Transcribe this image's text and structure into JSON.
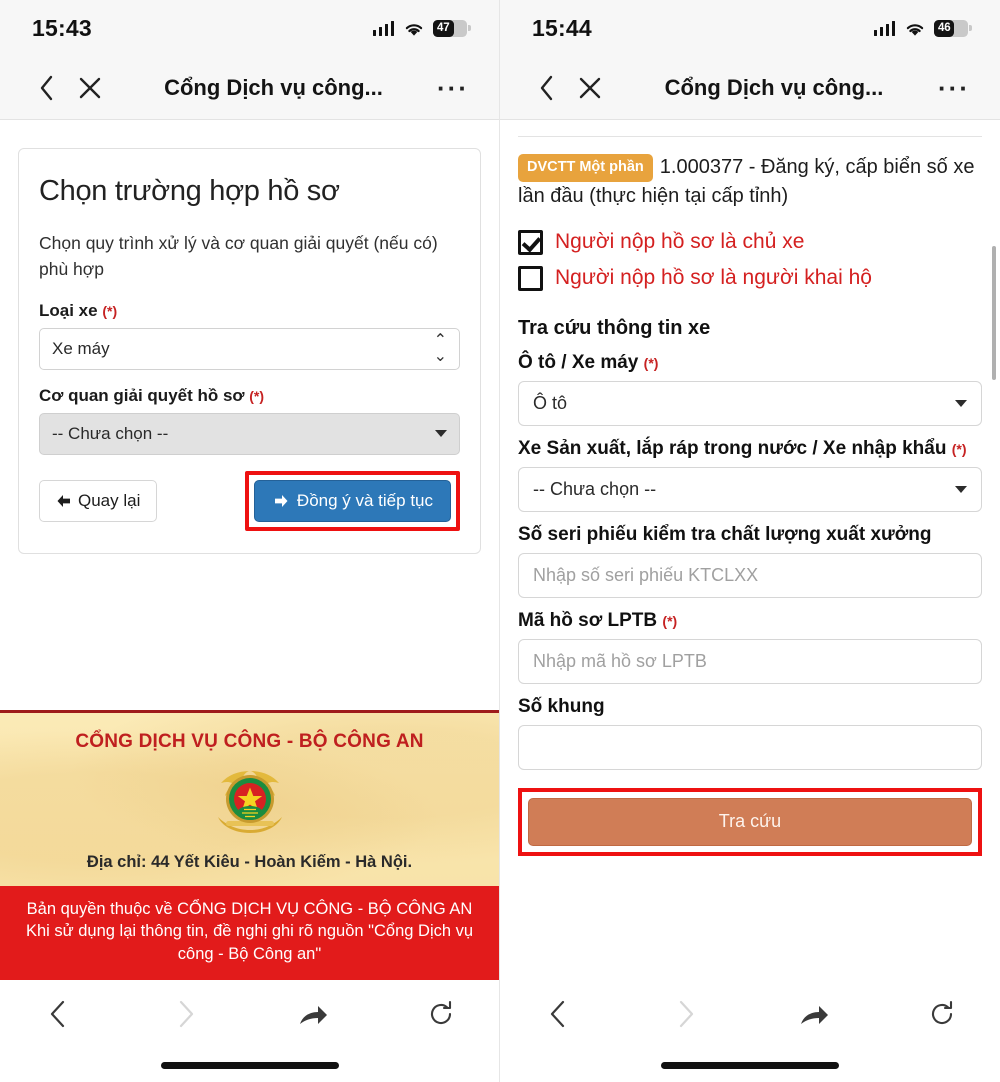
{
  "screens": [
    {
      "id": "left",
      "status": {
        "time": "15:43",
        "battery": "47",
        "battery_pct": 47,
        "wifi": "wifi-icon",
        "signal": "cellular-signal-icon"
      },
      "browser": {
        "back_icon": "chevron-left-icon",
        "close_icon": "close-icon",
        "title": "Cổng Dịch vụ công...",
        "more_icon": "more-options-icon",
        "bottom": {
          "back_icon": "chevron-left-icon",
          "forward_icon": "chevron-right-icon",
          "share_icon": "share-icon",
          "reload_icon": "reload-icon"
        }
      },
      "card": {
        "heading": "Chọn trường hợp hồ sơ",
        "subtitle": "Chọn quy trình xử lý và cơ quan giải quyết (nếu có) phù hợp",
        "fields": [
          {
            "label": "Loại xe",
            "required": "(*)",
            "value": "Xe máy",
            "control": "native-select"
          },
          {
            "label": "Cơ quan giải quyết hồ sơ",
            "required": "(*)",
            "value": "-- Chưa chọn --",
            "control": "dropdown"
          }
        ],
        "back_button": "Quay lại",
        "back_button_icon": "arrow-left-icon",
        "submit_button": "Đồng ý và tiếp tục",
        "submit_button_icon": "arrow-right-icon",
        "highlight_color": "#ee1111",
        "submit_color": "#2d78b8"
      },
      "footer": {
        "title": "CỔNG DỊCH VỤ CÔNG - BỘ CÔNG AN",
        "emblem": "vietnam-police-emblem",
        "address": "Địa chỉ: 44 Yết Kiêu - Hoàn Kiếm - Hà Nội.",
        "copyright_line1": "Bản quyền thuộc về CỔNG DỊCH VỤ CÔNG - BỘ CÔNG AN",
        "copyright_line2": "Khi sử dụng lại thông tin, đề nghị ghi rõ nguồn \"Cổng Dịch vụ công - Bộ Công an\"",
        "banner_bg": "#fbeab6",
        "copyright_bg": "#e21b1b",
        "title_color": "#bf1f1f"
      }
    },
    {
      "id": "right",
      "status": {
        "time": "15:44",
        "battery": "46",
        "battery_pct": 46,
        "wifi": "wifi-icon",
        "signal": "cellular-signal-icon"
      },
      "browser": {
        "back_icon": "chevron-left-icon",
        "close_icon": "close-icon",
        "title": "Cổng Dịch vụ công...",
        "more_icon": "more-options-icon",
        "bottom": {
          "back_icon": "chevron-left-icon",
          "forward_icon": "chevron-right-icon",
          "share_icon": "share-icon",
          "reload_icon": "reload-icon"
        }
      },
      "service": {
        "badge": "DVCTT Một phần",
        "badge_color": "#e8a33d",
        "name": "1.000377 - Đăng ký, cấp biển số xe lần đầu (thực hiện tại cấp tỉnh)"
      },
      "checkboxes": [
        {
          "label": "Người nộp hồ sơ là chủ xe",
          "checked": true
        },
        {
          "label": "Người nộp hồ sơ là người khai hộ",
          "checked": false
        }
      ],
      "section_title": "Tra cứu thông tin xe",
      "fields": [
        {
          "label": "Ô tô / Xe máy",
          "required": "(*)",
          "value": "Ô tô",
          "control": "dropdown"
        },
        {
          "label": "Xe Sản xuất, lắp ráp trong nước / Xe nhập khẩu",
          "required": "(*)",
          "value": "-- Chưa chọn --",
          "control": "dropdown"
        },
        {
          "label": "Số seri phiếu kiểm tra chất lượng xuất xưởng",
          "required": "",
          "value": "",
          "placeholder": "Nhập số seri phiếu KTCLXX",
          "control": "text"
        },
        {
          "label": "Mã hồ sơ LPTB",
          "required": "(*)",
          "value": "",
          "placeholder": "Nhập mã hồ sơ LPTB",
          "control": "text"
        },
        {
          "label": "Số khung",
          "required": "",
          "value": "",
          "placeholder": "",
          "control": "text"
        }
      ],
      "search_button": "Tra cứu",
      "search_button_color": "#d07d56",
      "highlight_color": "#ee1111"
    }
  ]
}
